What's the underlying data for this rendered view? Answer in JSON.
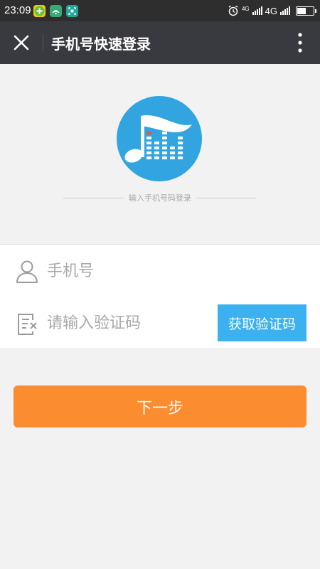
{
  "status_bar": {
    "time": "23:09",
    "network_small": "4G",
    "network": "4G",
    "battery_level": 0.6,
    "app_icons": [
      "green-plus-icon",
      "green-signal-icon",
      "teal-scan-icon"
    ]
  },
  "header": {
    "title": "手机号快速登录",
    "close_icon": "close-icon",
    "more_icon": "more-vertical-icon"
  },
  "logo": {
    "icon": "music-equalizer-icon",
    "color": "#32a5e0"
  },
  "hint": "输入手机号码登录",
  "form": {
    "phone": {
      "placeholder": "手机号",
      "value": "",
      "icon": "user-icon"
    },
    "code": {
      "placeholder": "请输入验证码",
      "value": "",
      "icon": "document-edit-icon"
    },
    "get_code_label": "获取验证码"
  },
  "next_label": "下一步",
  "colors": {
    "top_bar": "#393a3f",
    "status_bar": "#2e2e2e",
    "code_button": "#3bb2ef",
    "next_button": "#fb8c30",
    "background": "#f2f2f2"
  }
}
